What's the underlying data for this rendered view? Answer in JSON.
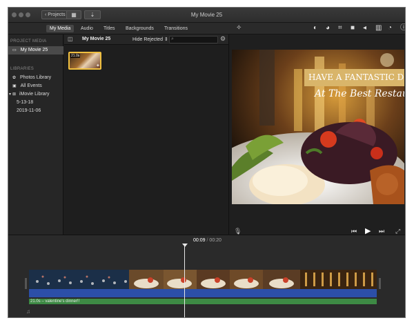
{
  "window": {
    "title": "My Movie 25",
    "projects_label": "Projects"
  },
  "toolbar": {
    "tabs": [
      "My Media",
      "Audio",
      "Titles",
      "Backgrounds",
      "Transitions"
    ],
    "active_tab": "My Media"
  },
  "sidebar": {
    "project_media_header": "PROJECT MEDIA",
    "project_item": "My Movie 25",
    "libraries_header": "LIBRARIES",
    "items": [
      "Photos Library",
      "All Events",
      "iMovie Library",
      "5-13-18",
      "2019-11-06"
    ]
  },
  "browser": {
    "title": "My Movie 25",
    "filter": "Hide Rejected",
    "clip_duration": "21.0s"
  },
  "viewer": {
    "title_line1": "HAVE A FANTASTIC DI",
    "title_line2": "At The Best Restaura"
  },
  "timeline": {
    "current_time": "00:09",
    "separator": "/",
    "total_time": "00:20",
    "audio_clip_label": "21.0s – valentine's dinner!!"
  },
  "colors": {
    "accent_selection": "#f0c040",
    "title_banner": "#d9b56a",
    "video_track": "#2c4fa8",
    "audio_track": "#3d8a44"
  }
}
